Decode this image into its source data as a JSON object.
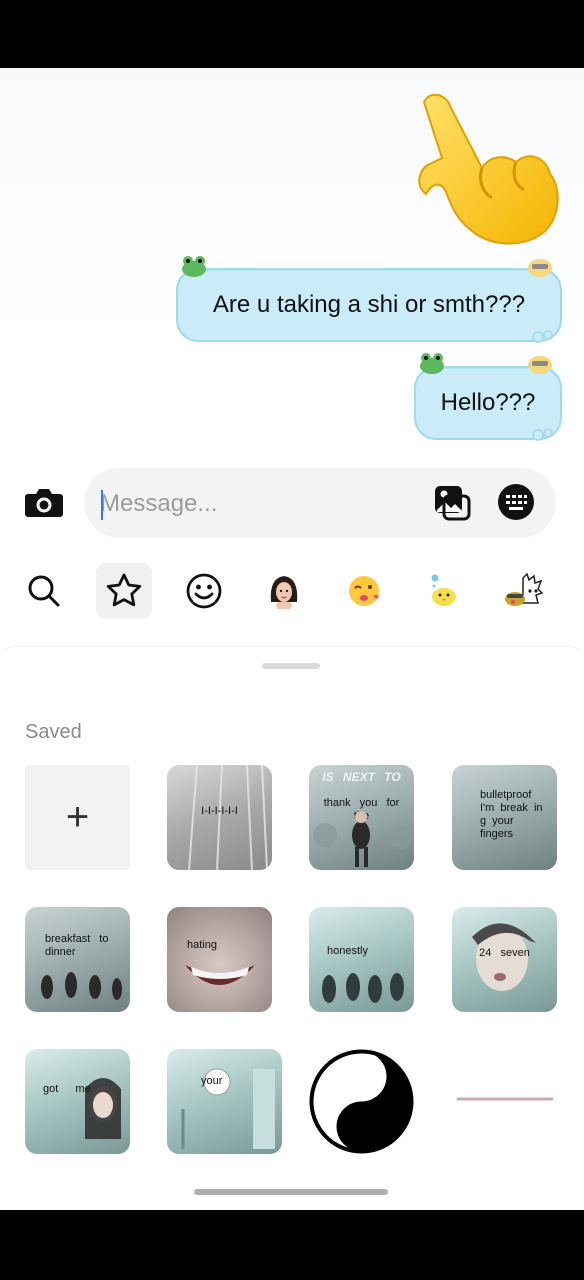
{
  "chat": {
    "messages": [
      {
        "text": "Are u taking a shi or smth???"
      },
      {
        "text": "Hello???"
      }
    ]
  },
  "composer": {
    "placeholder": "Message..."
  },
  "tabs": [
    {
      "icon": "search-icon"
    },
    {
      "icon": "star-icon",
      "active": true
    },
    {
      "icon": "emoji-icon"
    },
    {
      "icon": "avatar-sticker-icon"
    },
    {
      "icon": "wink-face-sticker-icon"
    },
    {
      "icon": "chick-sticker-icon"
    },
    {
      "icon": "cartoon-sticker-icon"
    }
  ],
  "sheet": {
    "section_title": "Saved",
    "add_label": "+",
    "stickers": [
      {
        "caption": "I-I-I-I-I-I"
      },
      {
        "caption": "thank you for the",
        "banner": "IS NEXT TO"
      },
      {
        "caption": "bulletproof I'm break in g your fingers"
      },
      {
        "caption": "breakfast to dinner"
      },
      {
        "caption": "hating"
      },
      {
        "caption": "honestly"
      },
      {
        "caption": "24 seven"
      },
      {
        "caption": "got me"
      },
      {
        "caption": "your"
      }
    ]
  },
  "colors": {
    "bubble": "#c9ecf8",
    "bubble_border": "#9fd9ee",
    "caret": "#3478f6"
  }
}
